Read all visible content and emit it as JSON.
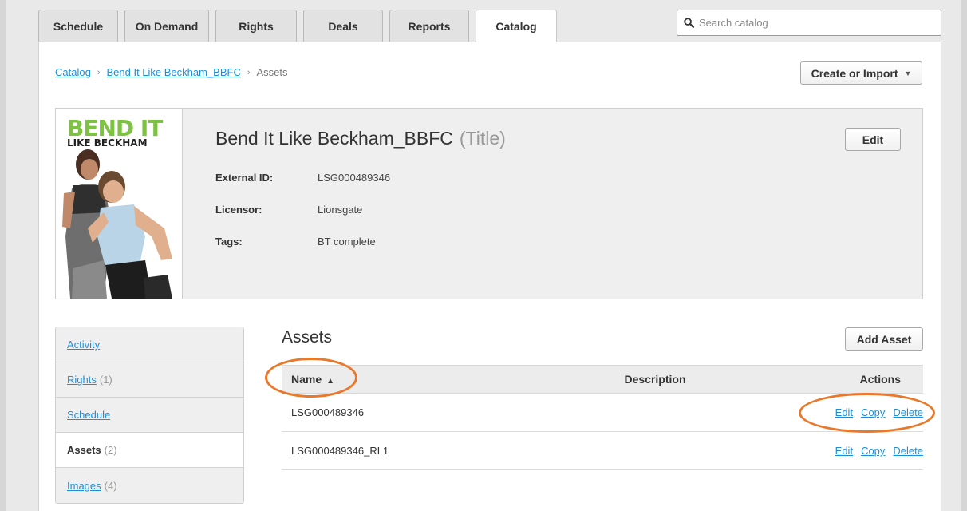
{
  "tabs": [
    {
      "label": "Schedule",
      "active": false
    },
    {
      "label": "On Demand",
      "active": false
    },
    {
      "label": "Rights",
      "active": false
    },
    {
      "label": "Deals",
      "active": false
    },
    {
      "label": "Reports",
      "active": false
    },
    {
      "label": "Catalog",
      "active": true
    }
  ],
  "search": {
    "placeholder": "Search catalog"
  },
  "breadcrumb": {
    "root": "Catalog",
    "title": "Bend It Like Beckham_BBFC",
    "current": "Assets"
  },
  "create_button": {
    "label": "Create or Import"
  },
  "title_card": {
    "poster_logo_line1": "BEND IT",
    "poster_logo_line2": "LIKE BECKHAM",
    "name": "Bend It Like Beckham_BBFC",
    "kind": "(Title)",
    "edit_label": "Edit",
    "fields": [
      {
        "label": "External ID:",
        "value": "LSG000489346"
      },
      {
        "label": "Licensor:",
        "value": "Lionsgate"
      },
      {
        "label": "Tags:",
        "value": "BT complete"
      }
    ]
  },
  "sidenav": [
    {
      "label": "Activity",
      "count": "",
      "active": false
    },
    {
      "label": "Rights",
      "count": "(1)",
      "active": false
    },
    {
      "label": "Schedule",
      "count": "",
      "active": false
    },
    {
      "label": "Assets",
      "count": "(2)",
      "active": true
    },
    {
      "label": "Images",
      "count": "(4)",
      "active": false
    }
  ],
  "assets": {
    "heading": "Assets",
    "add_label": "Add Asset",
    "columns": {
      "name": "Name",
      "description": "Description",
      "actions": "Actions"
    },
    "rows": [
      {
        "name": "LSG000489346",
        "description": "",
        "actions": [
          "Edit",
          "Copy",
          "Delete"
        ]
      },
      {
        "name": "LSG000489346_RL1",
        "description": "",
        "actions": [
          "Edit",
          "Copy",
          "Delete"
        ]
      }
    ]
  },
  "colors": {
    "link": "#1e8fd6",
    "callout": "#e9782a",
    "poster_green": "#7ec243"
  }
}
